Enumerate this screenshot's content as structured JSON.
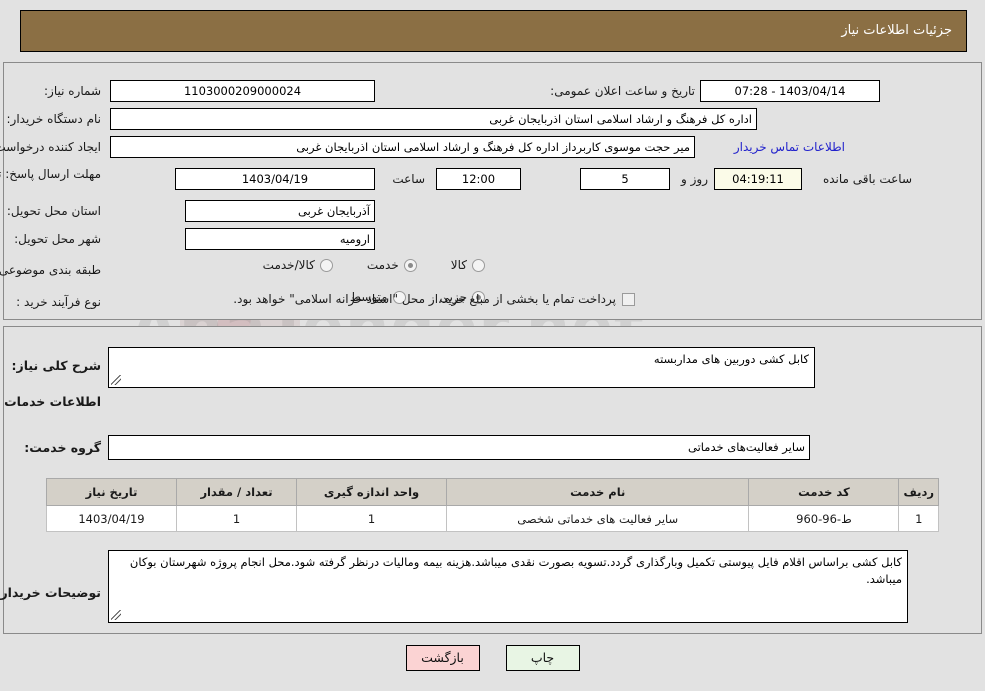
{
  "header": {
    "title": "جزئیات اطلاعات نیاز"
  },
  "colors": {
    "header_bg": "#8b6f44",
    "panel_bg": "#e2e2e2",
    "link": "#2222cc",
    "table_header_bg": "#d4d0c8",
    "print_button_bg": "#e8f5e4",
    "back_button_bg": "#fbd3d3",
    "countdown_bg": "#fbfbe8"
  },
  "form": {
    "need_number_label": "شماره نیاز:",
    "need_number_value": "1103000209000024",
    "public_announce_label": "تاریخ و ساعت اعلان عمومی:",
    "public_announce_value": "1403/04/14 - 07:28",
    "buyer_org_label": "نام دستگاه خریدار:",
    "buyer_org_value": "اداره کل فرهنگ و ارشاد اسلامی استان اذربایجان غربی",
    "creator_label": "ایجاد کننده درخواست:",
    "creator_value": "میر حجت موسوی کاربرداز اداره کل فرهنگ و ارشاد اسلامی استان اذربایجان غربی",
    "contact_link": "اطلاعات تماس خریدار",
    "deadline_label": "مهلت ارسال پاسخ: تا تاریخ:",
    "deadline_date": "1403/04/19",
    "deadline_hour_label": "ساعت",
    "deadline_time": "12:00",
    "remaining_days": "5",
    "remaining_days_label": "روز و",
    "remaining_time": "04:19:11",
    "remaining_time_label": "ساعت باقی مانده",
    "province_label": "استان محل تحویل:",
    "province_value": "آذربایجان غربی",
    "city_label": "شهر محل تحویل:",
    "city_value": "ارومیه",
    "category_label": "طبقه بندی موضوعی:",
    "category_options": [
      {
        "label": "کالا",
        "selected": false
      },
      {
        "label": "خدمت",
        "selected": true
      },
      {
        "label": "کالا/خدمت",
        "selected": false
      }
    ],
    "process_label": "نوع فرآیند خرید :",
    "process_options": [
      {
        "label": "جزیی",
        "selected": true
      },
      {
        "label": "متوسط",
        "selected": false
      }
    ],
    "treasury_checkbox_checked": false,
    "treasury_note": "پرداخت تمام یا بخشی از مبلغ خرید،از محل \"اسناد خزانه اسلامی\" خواهد بود."
  },
  "body": {
    "general_desc_label": "شرح کلی نیاز:",
    "general_desc_value": "کابل کشی دوربین های مداربسته",
    "services_section_title": "اطلاعات خدمات مورد نیاز",
    "service_group_label": "گروه خدمت:",
    "service_group_value": "سایر فعالیت‌های خدماتی",
    "buyer_notes_label": "توضیحات خریدار:",
    "buyer_notes_value": "کابل کشی براساس اقلام فایل پیوستی تکمیل وبارگذاری گردد.تسویه بصورت نقدی میباشد.هزینه بیمه ومالیات درنظر گرفته شود.محل انجام پروژه شهرستان بوکان میباشد."
  },
  "table": {
    "columns": [
      "ردیف",
      "کد خدمت",
      "نام خدمت",
      "واحد اندازه گیری",
      "تعداد / مقدار",
      "تاریخ نیاز"
    ],
    "rows": [
      {
        "row_no": "1",
        "service_code": "ط-96-960",
        "service_name": "سایر فعالیت های خدماتی شخصی",
        "unit": "1",
        "quantity": "1",
        "need_date": "1403/04/19"
      }
    ]
  },
  "buttons": {
    "print": "چاپ",
    "back": "بازگشت"
  },
  "watermark": {
    "text": "AnaTender.net"
  }
}
